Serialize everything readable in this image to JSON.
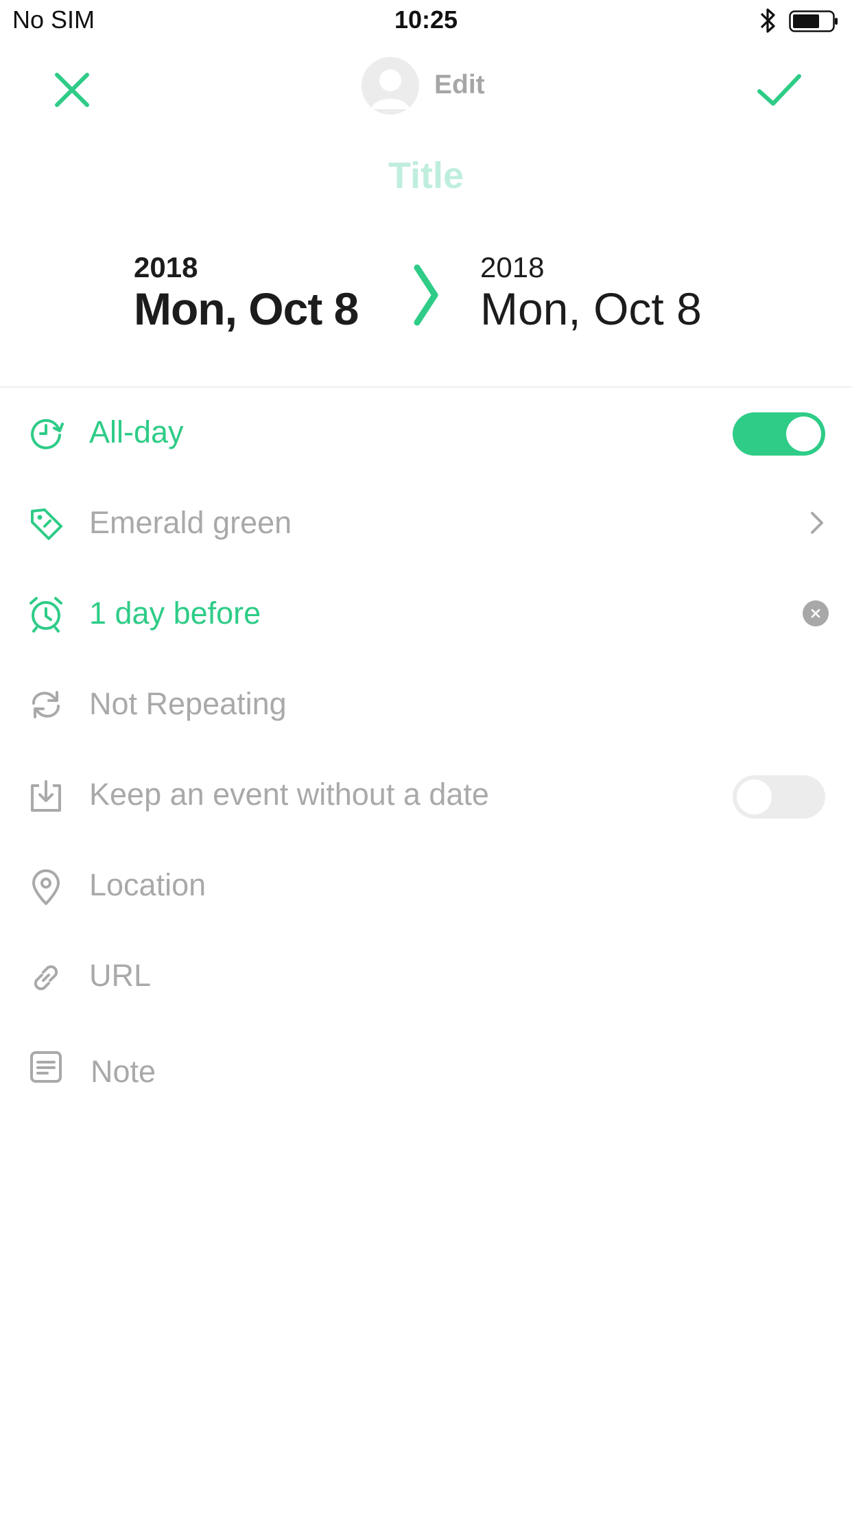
{
  "status_bar": {
    "carrier": "No SIM",
    "time": "10:25"
  },
  "nav": {
    "title": "Edit",
    "close_icon": "close-icon",
    "done_icon": "check-icon"
  },
  "event": {
    "title_placeholder": "Title",
    "start": {
      "year": "2018",
      "date": "Mon, Oct 8"
    },
    "end": {
      "year": "2018",
      "date": "Mon, Oct 8"
    }
  },
  "rows": {
    "all_day": {
      "label": "All-day",
      "on": true
    },
    "color": {
      "label": "Emerald green"
    },
    "alert": {
      "label": "1 day before"
    },
    "repeat": {
      "label": "Not Repeating"
    },
    "keep_undated": {
      "label": "Keep an event without a date",
      "on": false
    },
    "location": {
      "label": "Location"
    },
    "url": {
      "label": "URL"
    },
    "note": {
      "label": "Note"
    }
  },
  "colors": {
    "accent": "#2ecc87",
    "muted": "#a9a9a9",
    "title_placeholder": "#bfeedd"
  }
}
